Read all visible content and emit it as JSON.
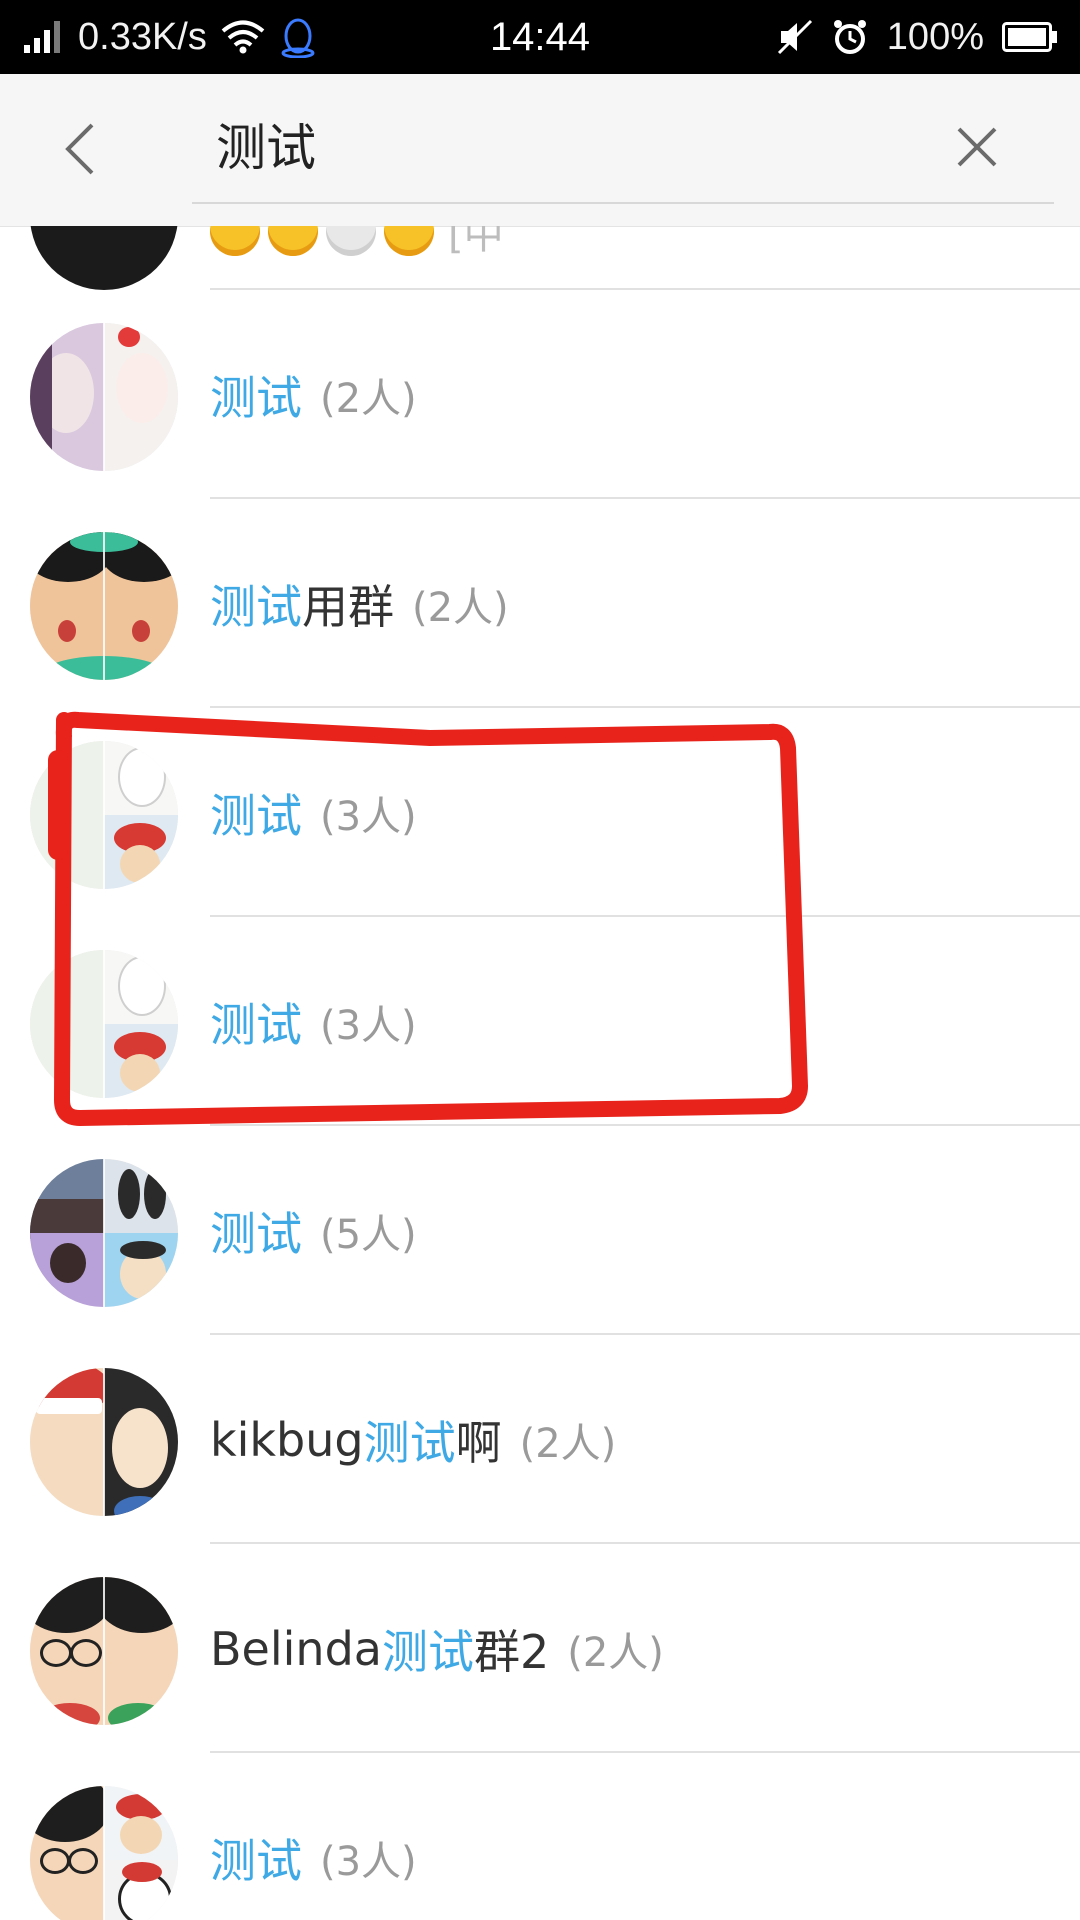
{
  "status_bar": {
    "speed": "0.33K/s",
    "time": "14:44",
    "battery": "100%",
    "icons": [
      "signal-icon",
      "wifi-icon",
      "qq-penguin-icon",
      "mute-icon",
      "alarm-icon",
      "battery-icon"
    ]
  },
  "search": {
    "query": "测试",
    "back_icon": "back-chevron-icon",
    "clear_icon": "close-icon"
  },
  "results": [
    {
      "pre": "",
      "hl": "测试",
      "post": "",
      "count": "(2人)"
    },
    {
      "pre": "",
      "hl": "测试",
      "post": "用群",
      "count": "(2人)"
    },
    {
      "pre": "",
      "hl": "测试",
      "post": "",
      "count": "(3人)"
    },
    {
      "pre": "",
      "hl": "测试",
      "post": "",
      "count": "(3人)"
    },
    {
      "pre": "",
      "hl": "测试",
      "post": "",
      "count": "(5人)"
    },
    {
      "pre": "kikbug",
      "hl": "测试",
      "post": "啊",
      "count": "(2人)"
    },
    {
      "pre": "Belinda",
      "hl": "测试",
      "post": "群2",
      "count": "(2人)"
    },
    {
      "pre": "",
      "hl": "测试",
      "post": "",
      "count": "(3人)"
    }
  ],
  "partial_row": {
    "text": "[中"
  },
  "colors": {
    "highlight": "#3fa9e6",
    "annotation": "#e8231b",
    "status_bar_bg": "#000000"
  }
}
